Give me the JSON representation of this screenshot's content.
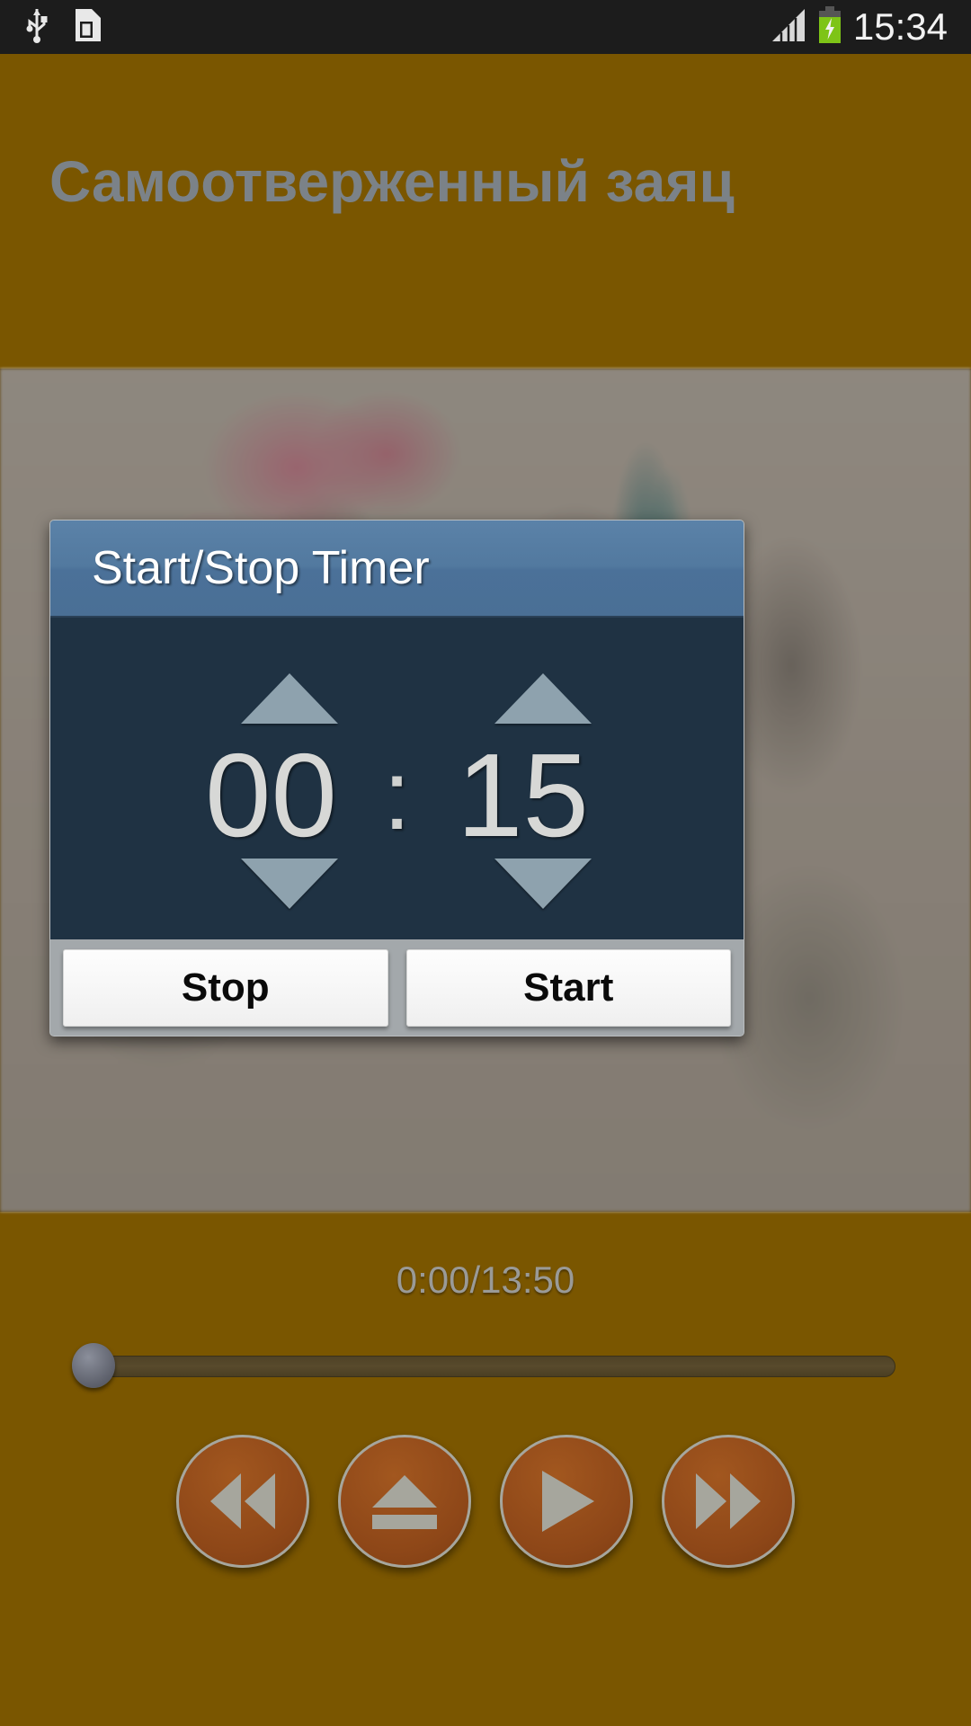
{
  "statusbar": {
    "time": "15:34",
    "icons": [
      "usb-icon",
      "sim-card-alert-icon",
      "signal-bars-icon",
      "battery-charging-icon"
    ]
  },
  "app": {
    "title": "Самоотверженный заяц",
    "background_color": "#7a5600",
    "title_color": "#7b8288"
  },
  "dialog": {
    "title": "Start/Stop Timer",
    "header_color": "#4e77a0",
    "body_color": "#1f3243",
    "footer_color": "#a3a8ab",
    "hours": "00",
    "separator": ":",
    "minutes": "15",
    "hours_up_label": "increase-hours",
    "hours_down_label": "decrease-hours",
    "minutes_up_label": "increase-minutes",
    "minutes_down_label": "decrease-minutes",
    "stop_label": "Stop",
    "start_label": "Start"
  },
  "player": {
    "time_display": "0:00/13:50",
    "elapsed": "0:00",
    "duration": "13:50",
    "progress_percent": 0,
    "buttons": [
      {
        "name": "rewind-button",
        "icon": "rewind-icon"
      },
      {
        "name": "eject-button",
        "icon": "eject-icon"
      },
      {
        "name": "play-button",
        "icon": "play-icon"
      },
      {
        "name": "fast-forward-button",
        "icon": "fast-forward-icon"
      }
    ],
    "button_color": "#8e4718",
    "icon_color": "#a6a69d"
  }
}
